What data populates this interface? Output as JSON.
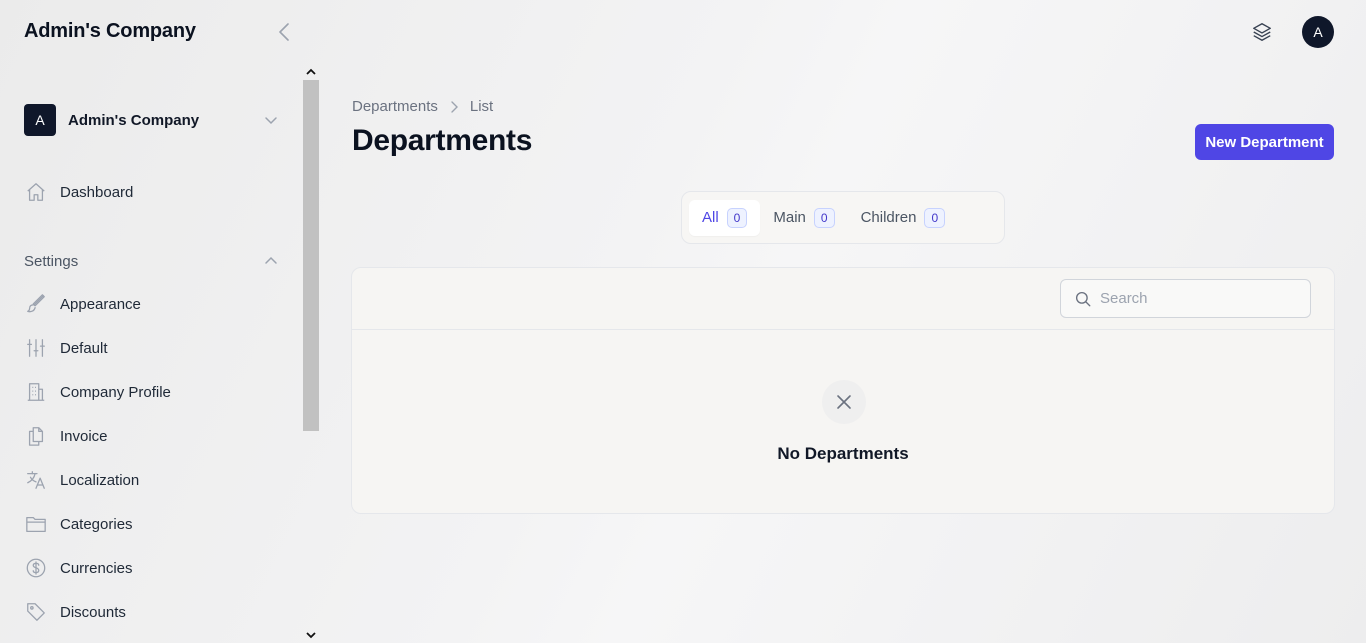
{
  "app": {
    "brand": "Admin's Company"
  },
  "topbar": {
    "avatar_initial": "A",
    "icons": [
      "chevron-left-icon",
      "layers-icon"
    ]
  },
  "sidebar": {
    "company": {
      "initial": "A",
      "name": "Admin's Company"
    },
    "dashboard": {
      "label": "Dashboard",
      "icon": "home-icon"
    },
    "settings": {
      "label": "Settings",
      "items": [
        {
          "label": "Appearance",
          "icon": "brush-icon"
        },
        {
          "label": "Default",
          "icon": "sliders-icon"
        },
        {
          "label": "Company Profile",
          "icon": "building-icon"
        },
        {
          "label": "Invoice",
          "icon": "documents-icon"
        },
        {
          "label": "Localization",
          "icon": "language-icon"
        },
        {
          "label": "Categories",
          "icon": "folder-icon"
        },
        {
          "label": "Currencies",
          "icon": "dollar-circle-icon"
        },
        {
          "label": "Discounts",
          "icon": "tag-icon"
        }
      ]
    }
  },
  "breadcrumb": {
    "parent": "Departments",
    "current": "List"
  },
  "page": {
    "title": "Departments",
    "new_button": "New Department"
  },
  "tabs": [
    {
      "label": "All",
      "count": "0",
      "active": true
    },
    {
      "label": "Main",
      "count": "0",
      "active": false
    },
    {
      "label": "Children",
      "count": "0",
      "active": false
    }
  ],
  "table": {
    "search_placeholder": "Search",
    "empty_message": "No Departments"
  },
  "colors": {
    "accent": "#4f46e5",
    "dark": "#0f172a"
  }
}
